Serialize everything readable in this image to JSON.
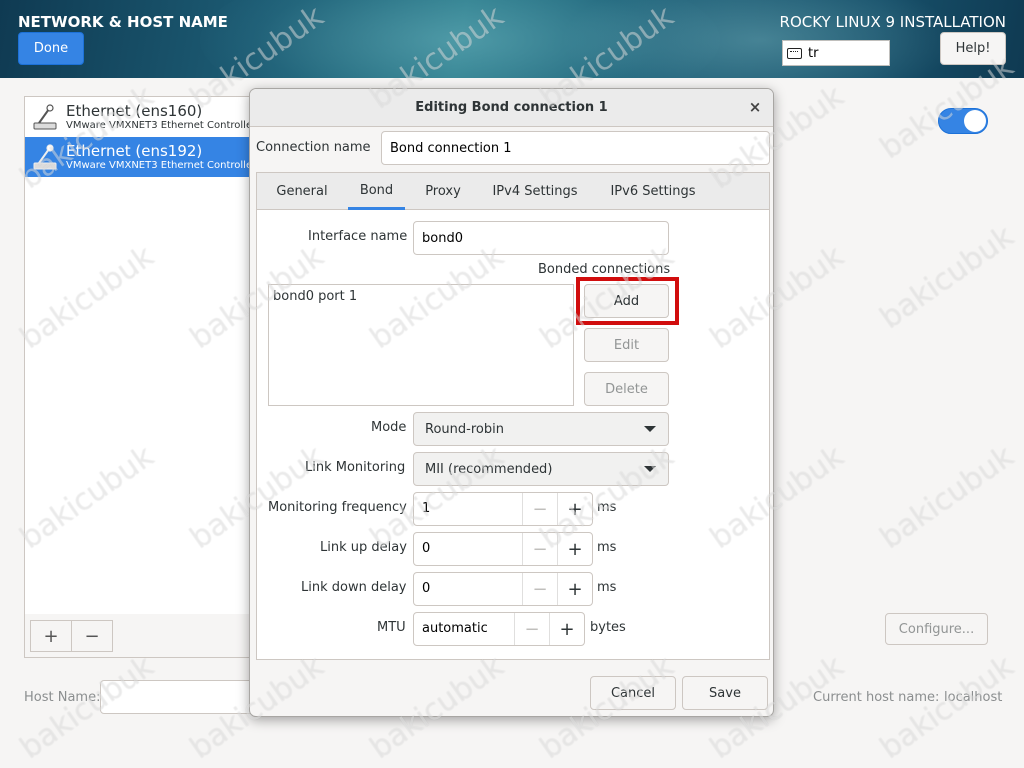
{
  "header": {
    "spoke_title": "NETWORK & HOST NAME",
    "done_label": "Done",
    "product_title": "ROCKY LINUX 9 INSTALLATION",
    "keyboard_layout": "tr",
    "help_label": "Help!"
  },
  "devices": [
    {
      "name": "Ethernet (ens160)",
      "description": "VMware VMXNET3 Ethernet Controller",
      "selected": false
    },
    {
      "name": "Ethernet (ens192)",
      "description": "VMware VMXNET3 Ethernet Controller",
      "selected": true
    }
  ],
  "device_toolbar": {
    "add": "+",
    "remove": "−"
  },
  "device_toggle": {
    "on": true
  },
  "configure_label": "Configure...",
  "hostname": {
    "label": "Host Name:",
    "value": "",
    "current_label": "Current host name:",
    "current_value": "localhost"
  },
  "dialog": {
    "title": "Editing Bond connection 1",
    "close": "×",
    "connection_name_label": "Connection name",
    "connection_name_value": "Bond connection 1",
    "tabs": [
      "General",
      "Bond",
      "Proxy",
      "IPv4 Settings",
      "IPv6 Settings"
    ],
    "active_tab": "Bond",
    "bond": {
      "interface_name_label": "Interface name",
      "interface_name_value": "bond0",
      "bonded_connections_label": "Bonded connections",
      "bonded_connections": [
        "bond0 port 1"
      ],
      "add_label": "Add",
      "edit_label": "Edit",
      "delete_label": "Delete",
      "mode_label": "Mode",
      "mode_value": "Round-robin",
      "link_monitoring_label": "Link Monitoring",
      "link_monitoring_value": "MII (recommended)",
      "monitoring_frequency_label": "Monitoring frequency",
      "monitoring_frequency_value": "1",
      "link_up_delay_label": "Link up delay",
      "link_up_delay_value": "0",
      "link_down_delay_label": "Link down delay",
      "link_down_delay_value": "0",
      "mtu_label": "MTU",
      "mtu_value": "automatic",
      "ms_unit": "ms",
      "bytes_unit": "bytes",
      "minus": "−",
      "plus": "+"
    },
    "cancel_label": "Cancel",
    "save_label": "Save"
  },
  "watermark": "bakicubuk",
  "colors": {
    "accent": "#3584e4",
    "highlight": "#d10d0d"
  }
}
